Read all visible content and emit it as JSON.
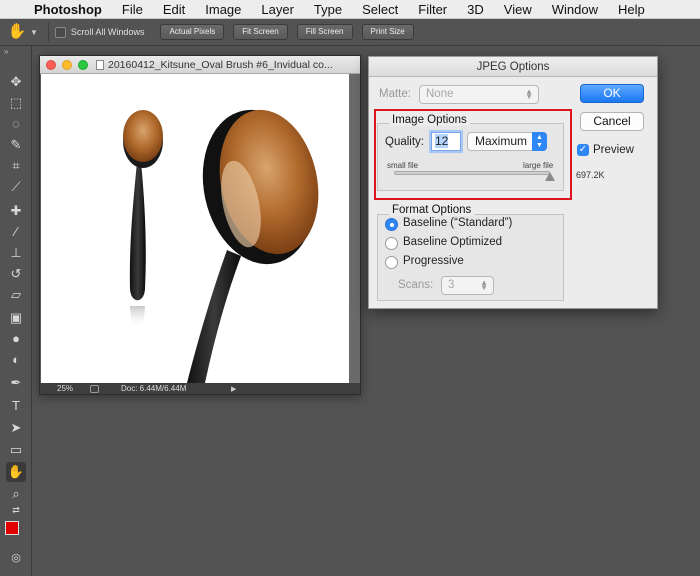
{
  "menubar": {
    "app": "Photoshop",
    "items": [
      "File",
      "Edit",
      "Image",
      "Layer",
      "Type",
      "Select",
      "Filter",
      "3D",
      "View",
      "Window",
      "Help"
    ]
  },
  "options_bar": {
    "tool_icon": "hand-tool-icon",
    "scroll_all_label": "Scroll All Windows",
    "scroll_all_checked": false,
    "buttons": [
      "Actual Pixels",
      "Fit Screen",
      "Fill Screen",
      "Print Size"
    ]
  },
  "toolbar": {
    "tools": [
      "move-icon",
      "marquee-icon",
      "lasso-icon",
      "quick-select-icon",
      "crop-icon",
      "eyedropper-icon",
      "healing-brush-icon",
      "brush-icon",
      "clone-stamp-icon",
      "history-brush-icon",
      "eraser-icon",
      "gradient-icon",
      "blur-icon",
      "dodge-icon",
      "pen-icon",
      "type-icon",
      "path-select-icon",
      "rectangle-icon",
      "hand-icon",
      "zoom-icon"
    ],
    "active_tool": "hand-icon",
    "foreground_color": "#e00000",
    "background_color": "#ffffff"
  },
  "document": {
    "title": "20160412_Kitsune_Oval Brush #6_Invidual co...",
    "zoom": "25%",
    "doc_size": "Doc: 6.44M/6.44M"
  },
  "jpeg_dialog": {
    "title": "JPEG Options",
    "matte_label": "Matte:",
    "matte_value": "None",
    "image_options_title": "Image Options",
    "quality_label": "Quality:",
    "quality_value": "12",
    "quality_preset": "Maximum",
    "small_file_label": "small file",
    "large_file_label": "large file",
    "quality_slider_fraction": 1.0,
    "format_options_title": "Format Options",
    "formats": [
      "Baseline (“Standard”)",
      "Baseline Optimized",
      "Progressive"
    ],
    "selected_format": 0,
    "scans_label": "Scans:",
    "scans_value": "3",
    "ok_label": "OK",
    "cancel_label": "Cancel",
    "preview_label": "Preview",
    "preview_checked": true,
    "file_size": "697.2K"
  },
  "colors": {
    "accent": "#2f86f5",
    "highlight_box": "#e0141e"
  }
}
